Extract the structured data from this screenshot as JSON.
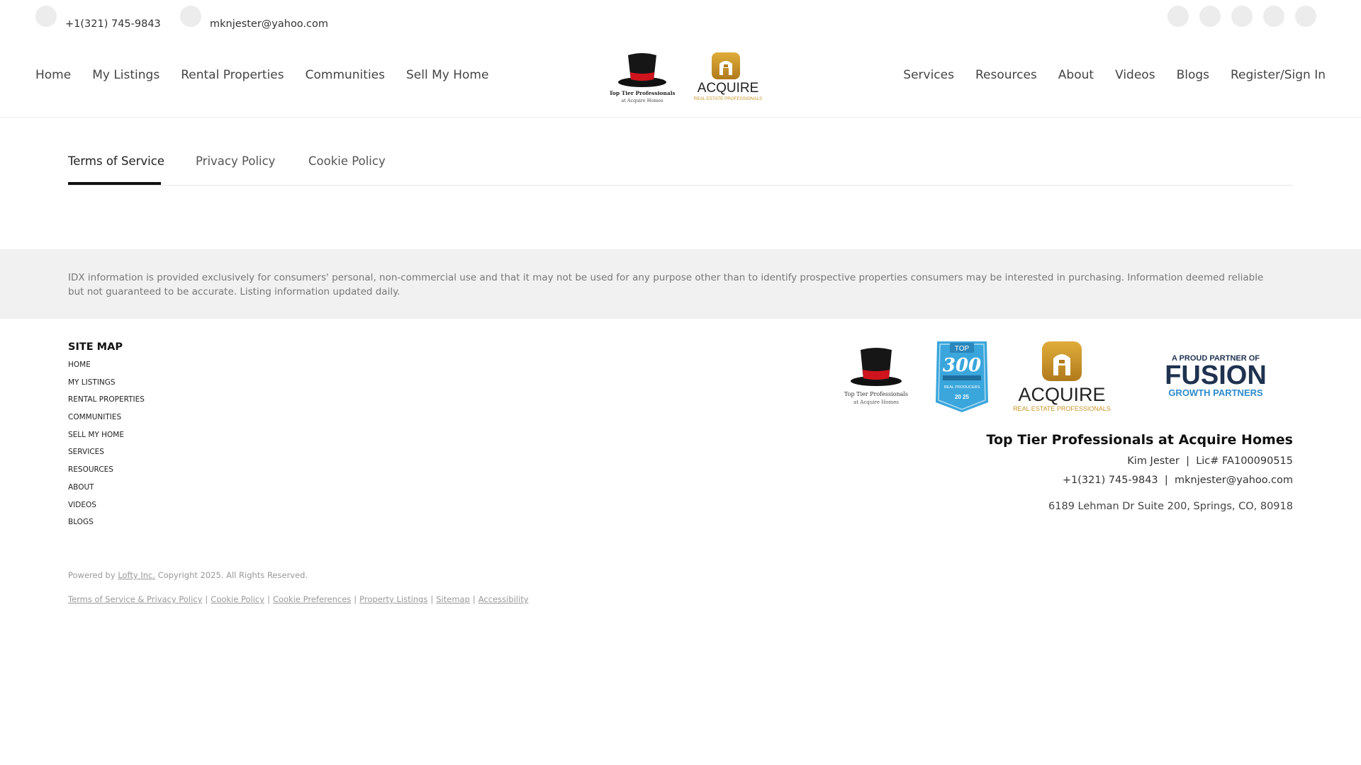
{
  "topbar": {
    "phone": "+1(321) 745-9843",
    "email": "mknjester@yahoo.com",
    "socials": [
      "social-icon-1",
      "social-icon-2",
      "social-icon-3",
      "social-icon-4",
      "social-icon-5"
    ]
  },
  "nav": {
    "left": [
      "Home",
      "My Listings",
      "Rental Properties",
      "Communities",
      "Sell My Home"
    ],
    "right": [
      "Services",
      "Resources",
      "About",
      "Videos",
      "Blogs"
    ],
    "register": "Register/Sign In"
  },
  "logos": {
    "hat_line1": "Top Tier Professionals",
    "hat_line2": "at Acquire Homes",
    "acquire_name": "ACQUIRE",
    "acquire_sub": "REAL ESTATE PROFESSIONALS",
    "top300_top": "TOP",
    "top300_num": "300",
    "top300_sub": "REAL PRODUCERS",
    "top300_year": "20 25",
    "fusion_top": "A PROUD PARTNER OF",
    "fusion_name": "FUSION",
    "fusion_sub": "GROWTH PARTNERS"
  },
  "tabs": [
    {
      "label": "Terms of Service",
      "active": true
    },
    {
      "label": "Privacy Policy",
      "active": false
    },
    {
      "label": "Cookie Policy",
      "active": false
    }
  ],
  "idx_text": "IDX information is provided exclusively for consumers' personal, non-commercial use and that it may not be used for any purpose other than to identify prospective properties consumers may be interested in purchasing. Information deemed reliable but not guaranteed to be accurate. Listing information updated daily.",
  "sitemap": {
    "title": "SITE MAP",
    "items": [
      "HOME",
      "MY LISTINGS",
      "RENTAL PROPERTIES",
      "COMMUNITIES",
      "SELL MY HOME",
      "SERVICES",
      "RESOURCES",
      "ABOUT",
      "VIDEOS",
      "BLOGS"
    ]
  },
  "footer": {
    "brand": "Top Tier Professionals at Acquire Homes",
    "agent": "Kim Jester",
    "license": "Lic# FA100090515",
    "phone": "+1(321) 745-9843",
    "email": "mknjester@yahoo.com",
    "address": "6189 Lehman Dr Suite 200, Springs, CO, 80918"
  },
  "powered": {
    "prefix": "Powered by",
    "company": "Lofty Inc.",
    "copyright": "Copyright 2025. All Rights Reserved."
  },
  "legal_links": [
    "Terms of Service & Privacy Policy",
    "Cookie Policy",
    "Cookie Preferences",
    "Property Listings",
    "Sitemap",
    "Accessibility"
  ],
  "colors": {
    "gold": "#c9962a",
    "hat_band": "#d0141e",
    "badge_blue": "#3aa6dc",
    "fusion_navy": "#1f3350",
    "fusion_blue": "#2e8bcb"
  }
}
